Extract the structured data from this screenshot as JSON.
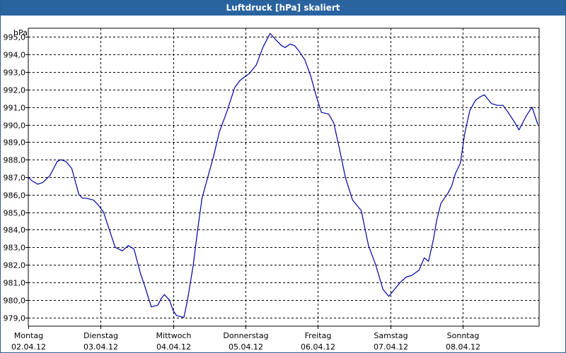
{
  "window": {
    "title": "Luftdruck [hPa] skaliert"
  },
  "colors": {
    "title_bar": "#2a64a0",
    "line": "#0000a0",
    "grid": "#000000",
    "background": "#ffffff"
  },
  "chart_data": {
    "type": "line",
    "title": "Luftdruck [hPa] skaliert",
    "ylabel": "hPa",
    "xlabel": "",
    "grid": true,
    "ylim": [
      978.5,
      995.5
    ],
    "xlim": [
      0,
      7.05
    ],
    "y_ticks": [
      979,
      980,
      981,
      982,
      983,
      984,
      985,
      986,
      987,
      988,
      989,
      990,
      991,
      992,
      993,
      994,
      995
    ],
    "y_tick_labels": [
      "979,0",
      "980,0",
      "981,0",
      "982,0",
      "983,0",
      "984,0",
      "985,0",
      "986,0",
      "987,0",
      "988,0",
      "989,0",
      "990,0",
      "991,0",
      "992,0",
      "993,0",
      "994,0",
      "995,0"
    ],
    "x_ticks": [
      {
        "day": "Montag",
        "date": "02.04.12"
      },
      {
        "day": "Dienstag",
        "date": "03.04.12"
      },
      {
        "day": "Mittwoch",
        "date": "04.04.12"
      },
      {
        "day": "Donnerstag",
        "date": "05.04.12"
      },
      {
        "day": "Freitag",
        "date": "06.04.12"
      },
      {
        "day": "Samstag",
        "date": "07.04.12"
      },
      {
        "day": "Sonntag",
        "date": "08.04.12"
      }
    ],
    "series": [
      {
        "x": [
          0,
          0.05,
          0.13,
          0.2,
          0.3,
          0.4,
          0.45,
          0.52,
          0.6,
          0.7,
          0.75,
          0.8,
          0.9,
          0.97,
          1.04,
          1.12,
          1.2,
          1.3,
          1.38,
          1.46,
          1.55,
          1.6,
          1.7,
          1.79,
          1.84,
          1.88,
          1.95,
          2.0,
          2.05,
          2.15,
          2.2,
          2.28,
          2.34,
          2.4,
          2.48,
          2.56,
          2.64,
          2.74,
          2.85,
          2.92,
          2.98,
          3.05,
          3.15,
          3.24,
          3.34,
          3.43,
          3.5,
          3.55,
          3.62,
          3.68,
          3.74,
          3.82,
          3.9,
          3.98,
          4.05,
          4.15,
          4.22,
          4.3,
          4.38,
          4.48,
          4.6,
          4.7,
          4.8,
          4.9,
          4.98,
          5.06,
          5.14,
          5.22,
          5.3,
          5.4,
          5.47,
          5.53,
          5.6,
          5.64,
          5.7,
          5.8,
          5.85,
          5.9,
          5.97,
          6.03,
          6.1,
          6.18,
          6.25,
          6.3,
          6.4,
          6.48,
          6.56,
          6.63,
          6.71,
          6.78,
          6.88,
          6.96,
          7.04
        ],
        "y": [
          987.0,
          986.8,
          986.6,
          986.7,
          987.1,
          987.9,
          988.0,
          987.9,
          987.5,
          986.0,
          985.8,
          985.8,
          985.7,
          985.4,
          985.0,
          984.0,
          983.0,
          982.8,
          983.1,
          982.9,
          981.5,
          980.9,
          979.6,
          979.7,
          980.1,
          980.3,
          980.0,
          979.4,
          979.1,
          979.0,
          980.0,
          982.0,
          984.0,
          985.8,
          987.0,
          988.2,
          989.6,
          990.7,
          992.1,
          992.5,
          992.7,
          992.9,
          993.4,
          994.4,
          995.2,
          994.8,
          994.5,
          994.4,
          994.6,
          994.5,
          994.2,
          993.7,
          992.8,
          991.6,
          990.7,
          990.6,
          990.1,
          988.6,
          987.0,
          985.7,
          985.1,
          983.1,
          982.0,
          980.6,
          980.2,
          980.6,
          981.0,
          981.3,
          981.4,
          981.7,
          982.4,
          982.2,
          983.5,
          984.5,
          985.5,
          986.1,
          986.5,
          987.2,
          987.8,
          989.5,
          990.8,
          991.4,
          991.6,
          991.7,
          991.2,
          991.1,
          991.1,
          990.7,
          990.2,
          989.7,
          990.5,
          991.0,
          990.0
        ]
      }
    ]
  }
}
